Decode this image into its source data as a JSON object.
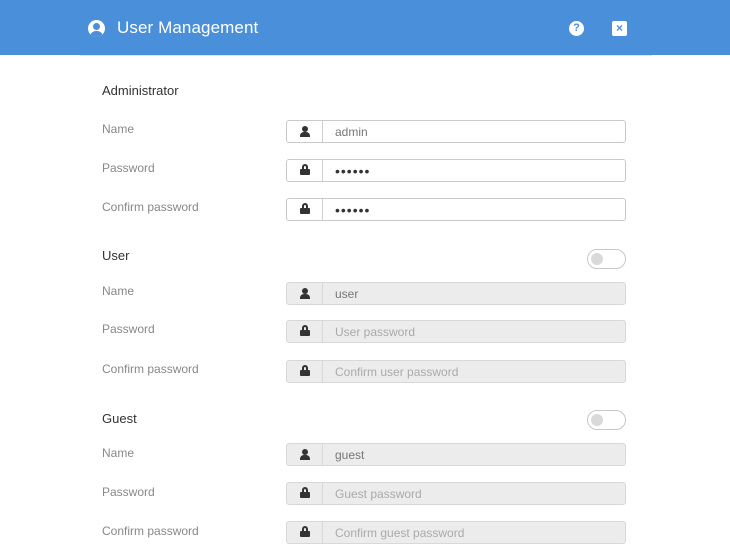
{
  "window": {
    "title": "User Management",
    "help_icon": "?",
    "close_icon": "×"
  },
  "sections": {
    "admin": {
      "title": "Administrator",
      "name_label": "Name",
      "name_value": "admin",
      "password_label": "Password",
      "password_value": "••••••",
      "confirm_label": "Confirm password",
      "confirm_value": "••••••"
    },
    "user": {
      "title": "User",
      "enabled": false,
      "name_label": "Name",
      "name_value": "user",
      "password_label": "Password",
      "password_placeholder": "User password",
      "confirm_label": "Confirm password",
      "confirm_placeholder": "Confirm user password"
    },
    "guest": {
      "title": "Guest",
      "enabled": false,
      "name_label": "Name",
      "name_value": "guest",
      "password_label": "Password",
      "password_placeholder": "Guest password",
      "confirm_label": "Confirm password",
      "confirm_placeholder": "Confirm guest password"
    }
  },
  "colors": {
    "titlebar": "#4a8fd9",
    "disabled_field": "#ececec"
  }
}
